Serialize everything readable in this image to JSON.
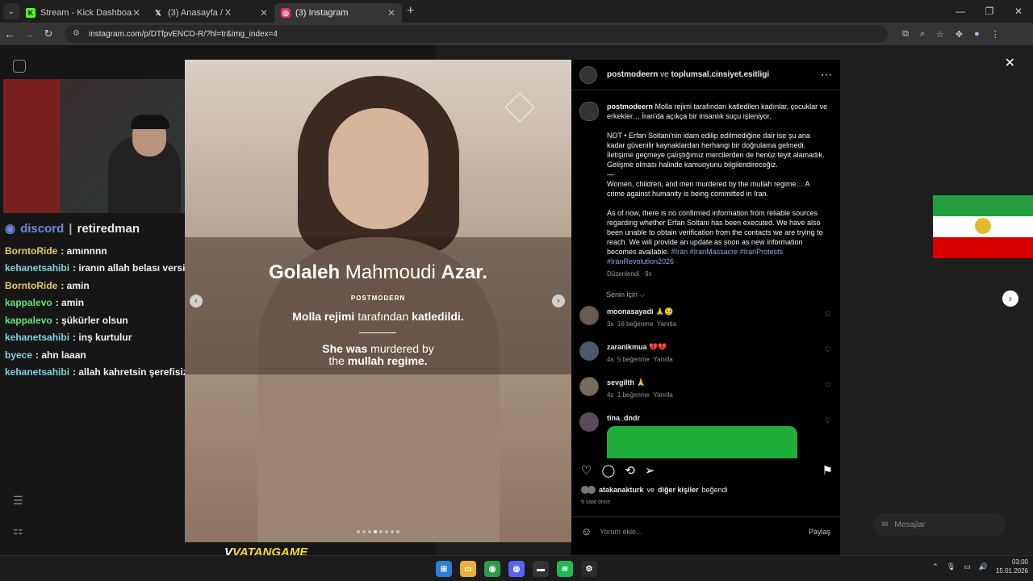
{
  "browser": {
    "tabs": [
      {
        "icon": "K",
        "color": "#53fc18",
        "title": "Stream - Kick Dashboard",
        "active": false
      },
      {
        "icon": "X",
        "color": "#ffffff",
        "title": "(3) Anasayfa / X",
        "active": false
      },
      {
        "icon": "◎",
        "color": "#e1306c",
        "title": "(3) Instagram",
        "active": true
      }
    ],
    "url": "instagram.com/p/DTfpvENCD-R/?hl=tr&img_index=4"
  },
  "stream": {
    "discord_label": "discord",
    "discord_user": "retiredman",
    "chat": [
      {
        "user": "BorntoRide",
        "color": "#e4c86a",
        "msg": "amınnnn"
      },
      {
        "user": "kehanetsahibi",
        "color": "#7fd3e0",
        "msg": "iranın allah belası versin inş abi"
      },
      {
        "user": "BorntoRide",
        "color": "#e4c86a",
        "msg": "amin"
      },
      {
        "user": "kappalevo",
        "color": "#5fe37a",
        "msg": "amin"
      },
      {
        "user": "kappalevo",
        "color": "#5fe37a",
        "msg": "şükürler olsun"
      },
      {
        "user": "kehanetsahibi",
        "color": "#7fd3e0",
        "msg": "inş kurtulur"
      },
      {
        "user": "byece",
        "color": "#7fd3e0",
        "msg": "ahn laaan"
      },
      {
        "user": "kehanetsahibi",
        "color": "#7fd3e0",
        "msg": "allah kahretsin şerefisize"
      }
    ],
    "watermark_left": "V",
    "watermark_right": "VATANGAME"
  },
  "post": {
    "media": {
      "name_bold1": "Golaleh",
      "name_mid": "Mahmoudi",
      "name_bold2": "Azar.",
      "brand": "POSTMODERN",
      "tr_pre": "Molla rejimi",
      "tr_mid": "tarafından",
      "tr_bold": "katledildi.",
      "en_line1_bold": "She was",
      "en_line1": "murdered by",
      "en_line2_pre": "the",
      "en_line2_bold": "mullah regime."
    },
    "header": {
      "user1": "postmodeern",
      "joiner": "ve",
      "user2": "toplumsal.cinsiyet.esitligi"
    },
    "caption": {
      "user": "postmodeern",
      "p1": "Molla rejimi tarafından katledilen kadınlar, çocuklar ve erkekler… İran'da açıkça bir insanlık suçu işleniyor.",
      "p2": "NOT • Erfan Soltani'nin idam edilip edilmediğine dair ise şu ana kadar güvenilir kaynaklardan herhangi bir doğrulama gelmedi. İletişime geçmeye çalıştığımız mercilerden de henüz teyit alamadık. Gelişme olması halinde kamuoyunu bilgilendireceğiz.",
      "dash": "—",
      "p3": "Women, children, and men murdered by the mullah regime… A crime against humanity is being committed in Iran.",
      "p4": "As of now, there is no confirmed information from reliable sources regarding whether Erfan Soltani has been executed. We have also been unable to obtain verification from the contacts we are trying to reach. We will provide an update as soon as new information becomes available.",
      "tags": "#Iran #IranMassacre #IranProtests #IranRevolution2026",
      "edited": "Düzenlendi · 9s"
    },
    "for_you": "Senin için ⌵",
    "comments": [
      {
        "user": "moonasayadi",
        "emoji": "🙏🥺",
        "time": "3s",
        "likes": "16 beğenme",
        "reply": "Yanıtla"
      },
      {
        "user": "zaranikmua",
        "emoji": "💔💔",
        "time": "4s",
        "likes": "5 beğenme",
        "reply": "Yanıtla"
      },
      {
        "user": "sevgilth",
        "emoji": "🙏",
        "time": "4s",
        "likes": "1 beğenme",
        "reply": "Yanıtla"
      },
      {
        "user": "tina_dndr",
        "emoji": "",
        "time": "",
        "likes": "",
        "reply": ""
      }
    ],
    "likes_user": "atakanakturk",
    "likes_joiner": "ve",
    "likes_others": "diğer kişiler",
    "likes_suffix": "beğendi",
    "ago": "9 saat önce",
    "comment_placeholder": "Yorum ekle...",
    "share": "Paylaş"
  },
  "messages_label": "Mesajlar",
  "clock": {
    "time": "03:00",
    "date": "15.01.2026"
  },
  "colors": {
    "iran_green": "#239f40",
    "iran_red": "#da0000",
    "instagram_link": "#8fa7e6"
  }
}
